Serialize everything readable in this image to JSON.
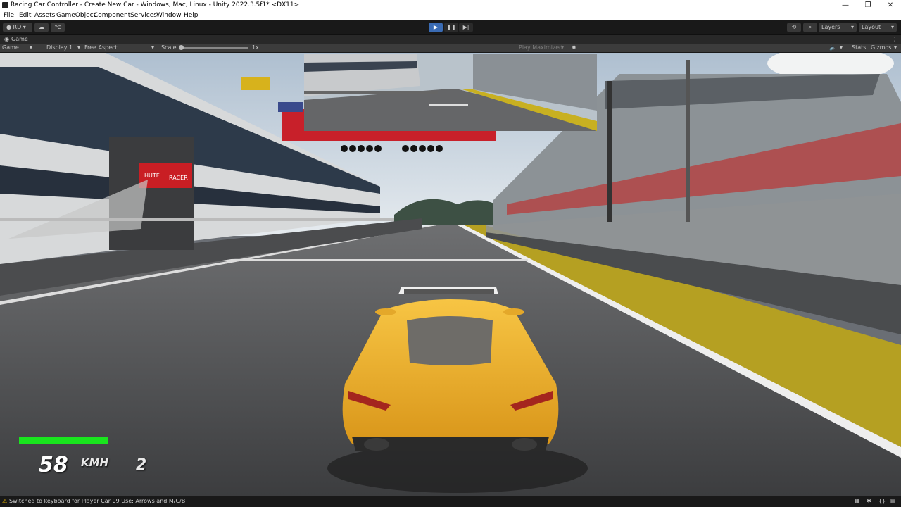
{
  "window": {
    "title": "Racing Car Controller - Create New Car - Windows, Mac, Linux - Unity 2022.3.5f1* <DX11>",
    "minimize": "—",
    "restore": "❐",
    "close": "✕"
  },
  "menu": {
    "items": [
      "File",
      "Edit",
      "Assets",
      "GameObject",
      "Component",
      "Services",
      "Window",
      "Help"
    ]
  },
  "toolbar": {
    "account": "RD",
    "layers": "Layers",
    "layout": "Layout",
    "play_icon": "play-icon",
    "pause_icon": "pause-icon",
    "step_icon": "step-icon"
  },
  "tab": {
    "label": "Game"
  },
  "gamebar": {
    "mode": "Game",
    "display": "Display 1",
    "aspect": "Free Aspect",
    "scale_label": "Scale",
    "scale_value": "1x",
    "play_maximized": "Play Maximized",
    "stats": "Stats",
    "gizmos": "Gizmos"
  },
  "scene": {
    "garage_sign_1": "HUTE",
    "garage_sign_2": "RACER"
  },
  "hud": {
    "speed": "58",
    "unit": "KMH",
    "gear": "2",
    "bar_fraction": 1.0,
    "bar_color": "#19e51e"
  },
  "status": {
    "message": "Switched to keyboard for Player Car 09  Use: Arrows and M/C/B"
  },
  "colors": {
    "accent": "#3a6bb3",
    "car": "#f1b52a"
  }
}
